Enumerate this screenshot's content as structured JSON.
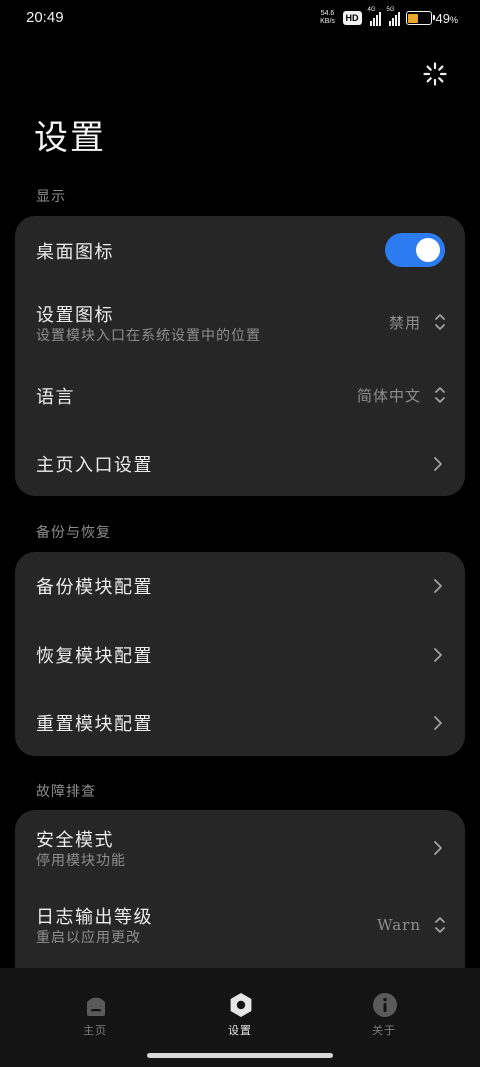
{
  "status_bar": {
    "time": "20:49",
    "net_speed_value": "54.6",
    "net_speed_unit": "KB/s",
    "hd_badge": "HD",
    "sim1_tag": "4G",
    "sim2_tag": "5G",
    "battery_percent": "49",
    "battery_suffix": "%",
    "battery_level": 0.49
  },
  "header": {
    "title": "设置",
    "action_icon": "loading-icon"
  },
  "sections": {
    "display": {
      "label": "显示",
      "desktop_icon": {
        "title": "桌面图标",
        "enabled": true
      },
      "settings_icon": {
        "title": "设置图标",
        "subtitle": "设置模块入口在系统设置中的位置",
        "value": "禁用"
      },
      "language": {
        "title": "语言",
        "value": "简体中文"
      },
      "home_entry": {
        "title": "主页入口设置"
      }
    },
    "backup": {
      "label": "备份与恢复",
      "backup_config": {
        "title": "备份模块配置"
      },
      "restore_config": {
        "title": "恢复模块配置"
      },
      "reset_config": {
        "title": "重置模块配置"
      }
    },
    "troubleshoot": {
      "label": "故障排查",
      "safe_mode": {
        "title": "安全模式",
        "subtitle": "停用模块功能"
      },
      "log_level": {
        "title": "日志输出等级",
        "subtitle": "重启以应用更改",
        "value": "Warn"
      }
    }
  },
  "bottom_nav": {
    "home": {
      "label": "主页",
      "icon": "home-icon"
    },
    "settings": {
      "label": "设置",
      "icon": "settings-icon",
      "active": true
    },
    "about": {
      "label": "关于",
      "icon": "info-icon"
    }
  },
  "colors": {
    "accent": "#2d7bf0",
    "background": "#000000",
    "card": "#262626",
    "battery": "#e8a92a"
  }
}
